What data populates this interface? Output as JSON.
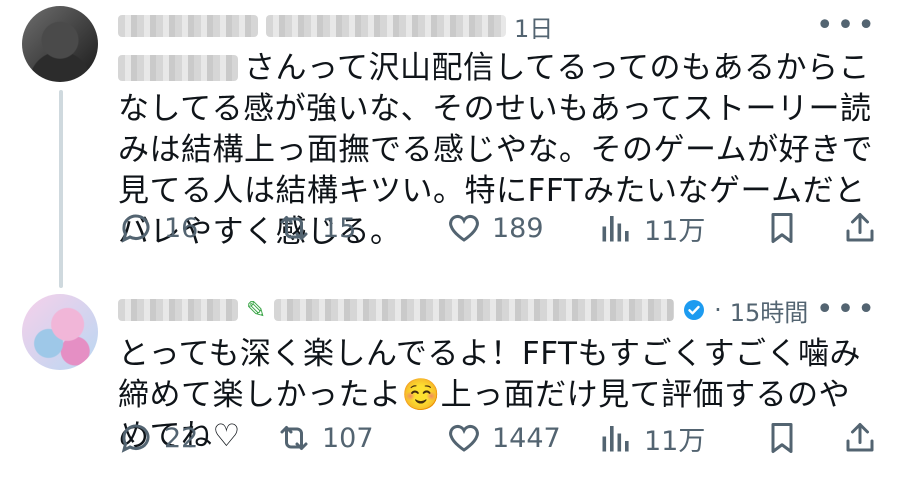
{
  "posts": [
    {
      "time": "1日",
      "text": "さんって沢山配信してるってのもあるからこなしてる感が強いな、そのせいもあってストーリー読みは結構上っ面撫でる感じやな。そのゲームが好きで見てる人は結構キツい。特にFFTみたいなゲームだとバレやすく感じる。",
      "replies": "16",
      "reposts": "15",
      "likes": "189",
      "views": "11万"
    },
    {
      "time": "15時間",
      "separator": "·",
      "text": "とっても深く楽しんでるよ！FFTもすごくすごく噛み締めて楽しかったよ☺️上っ面だけ見て評価するのやめてね♡",
      "replies": "22",
      "reposts": "107",
      "likes": "1447",
      "views": "11万"
    }
  ],
  "icons": {
    "reply": "speech-bubble-icon",
    "repost": "repost-arrows-icon",
    "like": "heart-icon",
    "views": "bar-chart-icon",
    "bookmark": "bookmark-icon",
    "share": "share-icon",
    "more": "more-dots-icon",
    "verified": "verified-badge-icon"
  },
  "colors": {
    "text": "#0f1419",
    "muted": "#536471",
    "verified": "#1d9bf0",
    "line": "#cfd9de"
  }
}
